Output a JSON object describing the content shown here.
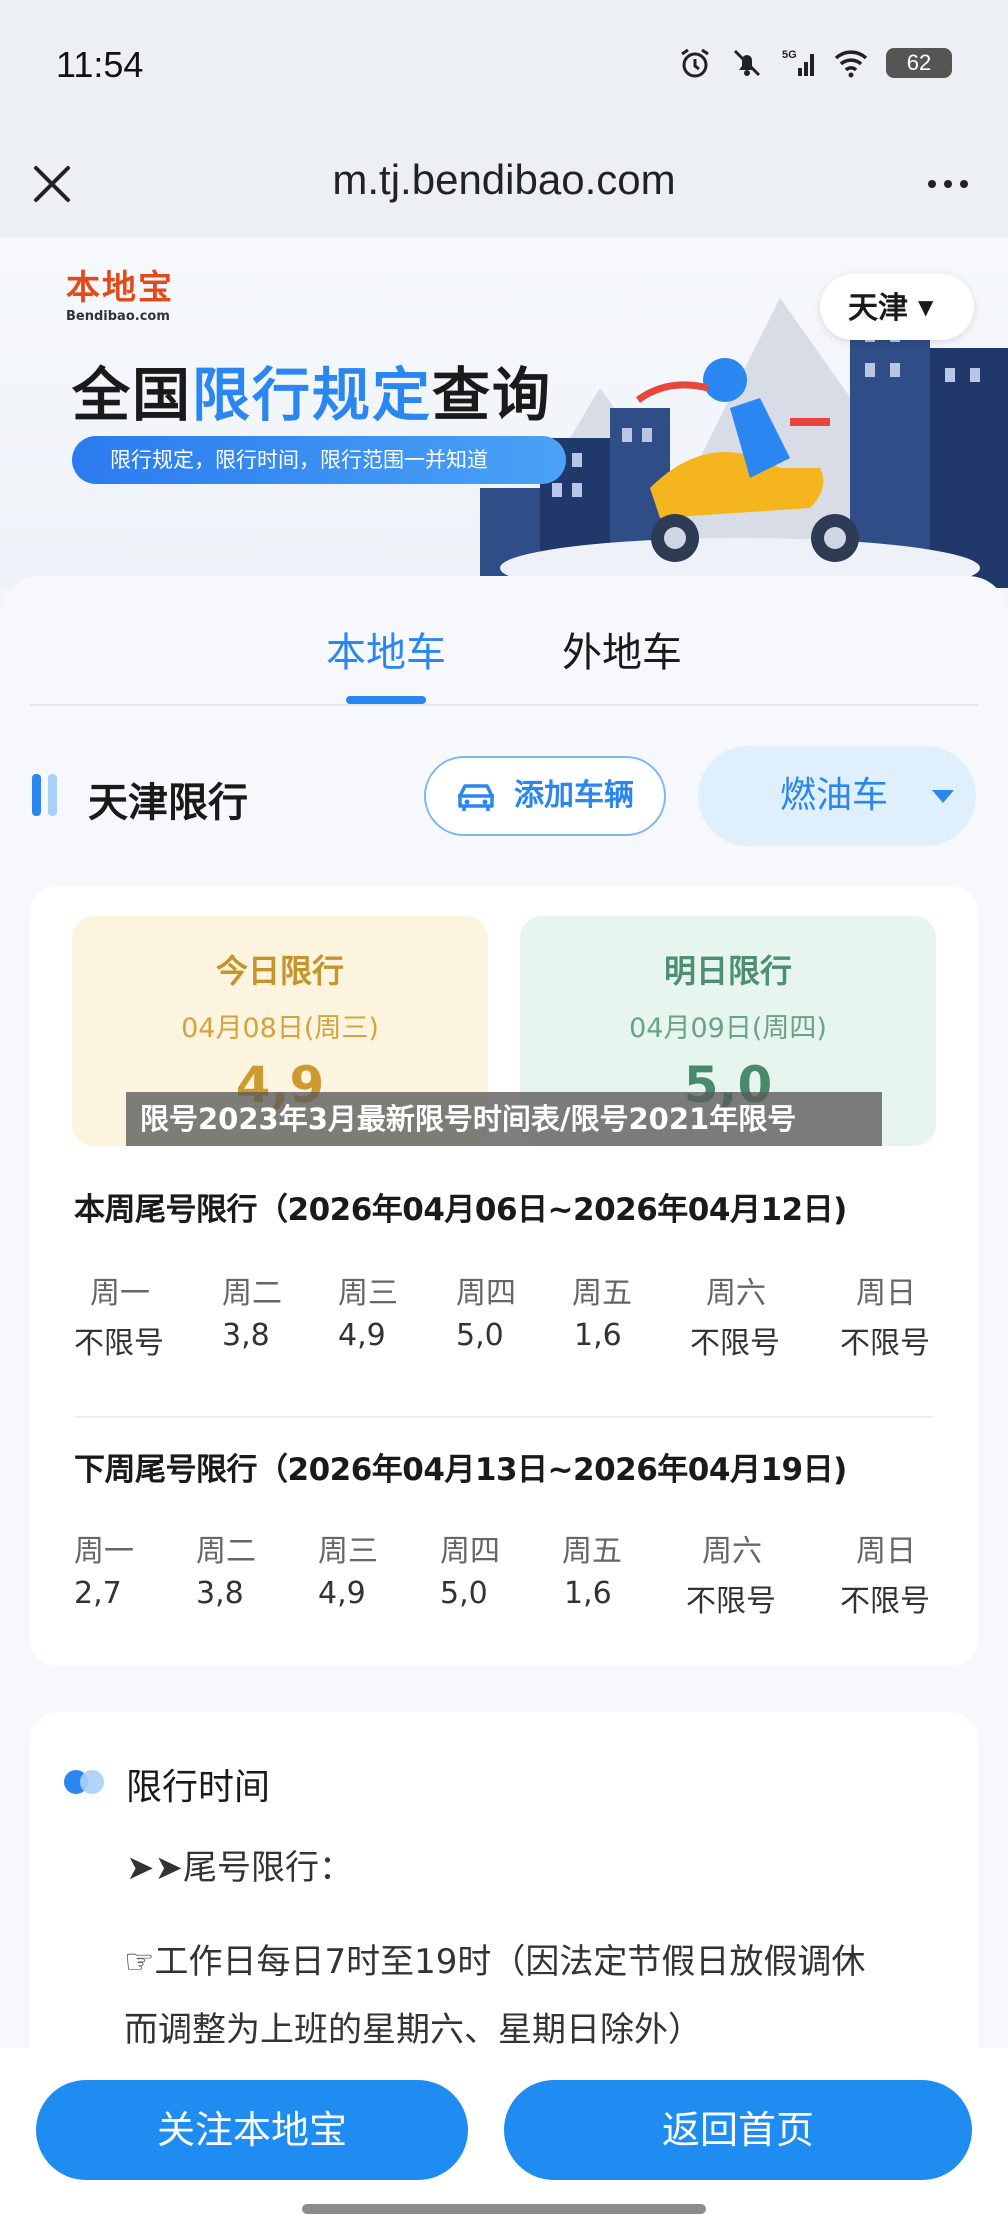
{
  "status_bar": {
    "time": "11:54",
    "network": "5G",
    "battery": "62"
  },
  "browser": {
    "url": "m.tj.bendibao.com"
  },
  "banner": {
    "logo_cn": "本地宝",
    "logo_en": "Bendibao.com",
    "title_prefix": "全国",
    "title_highlight": "限行规定",
    "title_suffix": "查询",
    "subtitle": "限行规定，限行时间，限行范围一并知道",
    "city": "天津"
  },
  "tabs": [
    {
      "label": "本地车",
      "active": true
    },
    {
      "label": "外地车",
      "active": false
    }
  ],
  "section": {
    "title": "天津限行",
    "add_vehicle": "添加车辆",
    "fuel_type": "燃油车"
  },
  "today": {
    "title": "今日限行",
    "date": "04月08日(周三)",
    "numbers": "4,9"
  },
  "tomorrow": {
    "title": "明日限行",
    "date": "04月09日(周四)",
    "numbers": "5,0"
  },
  "watermark": "限号2023年3月最新限号时间表/限号2021年限号",
  "this_week": {
    "title": "本周尾号限行（2026年04月06日~2026年04月12日)",
    "days": [
      "周一",
      "周二",
      "周三",
      "周四",
      "周五",
      "周六",
      "周日"
    ],
    "values": [
      "不限号",
      "3,8",
      "4,9",
      "5,0",
      "1,6",
      "不限号",
      "不限号"
    ]
  },
  "next_week": {
    "title": "下周尾号限行（2026年04月13日~2026年04月19日)",
    "days": [
      "周一",
      "周二",
      "周三",
      "周四",
      "周五",
      "周六",
      "周日"
    ],
    "values": [
      "2,7",
      "3,8",
      "4,9",
      "5,0",
      "1,6",
      "不限号",
      "不限号"
    ]
  },
  "time_section": {
    "title": "限行时间",
    "tail_label": "➤➤尾号限行：",
    "rule_line1": "☞工作日每日7时至19时（因法定节假日放假调休",
    "rule_line2": "而调整为上班的星期六、星期日除外）"
  },
  "bottom": {
    "follow": "关注本地宝",
    "home": "返回首页"
  },
  "colors": {
    "accent": "#2a86f0",
    "button": "#1f8cf2",
    "today_bg": "#fdf4e0",
    "tomorrow_bg": "#e6f5ee"
  }
}
